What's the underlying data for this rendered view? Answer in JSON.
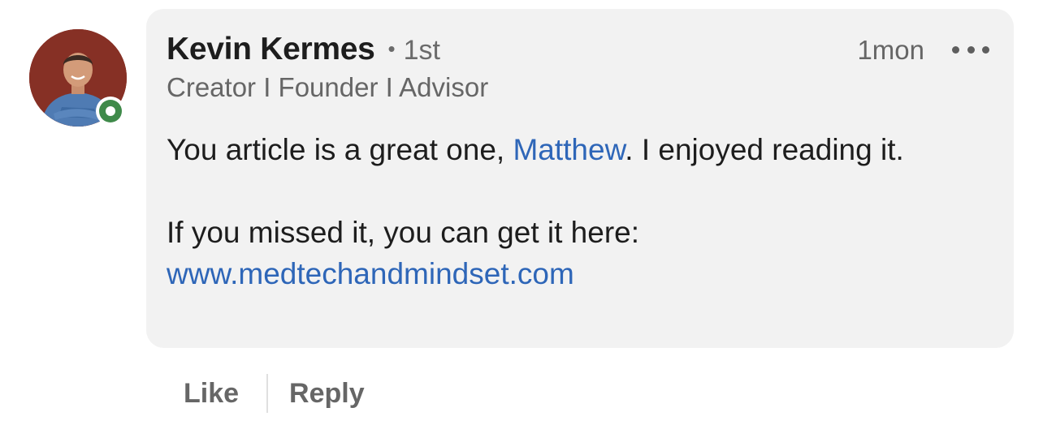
{
  "comment": {
    "author_name": "Kevin Kermes",
    "bullet": "•",
    "degree": "1st",
    "headline": "Creator I Founder I Advisor",
    "timestamp": "1mon",
    "body": {
      "line1_before": "You article is a great one, ",
      "mention": "Matthew",
      "line1_after": ". I enjoyed reading it.",
      "line2": "If you missed it, you can get it here:",
      "link": "www.medtechandmindset.com"
    },
    "avatar_icon": "profile-photo",
    "presence_icon": "online-status-icon",
    "more_icon": "more-options-icon"
  },
  "actions": {
    "like_label": "Like",
    "reply_label": "Reply"
  },
  "colors": {
    "bubble_bg": "#f2f2f2",
    "link": "#2e66b8",
    "presence": "#3f8a4a",
    "text_primary": "#1d1d1d",
    "text_secondary": "#666666"
  }
}
